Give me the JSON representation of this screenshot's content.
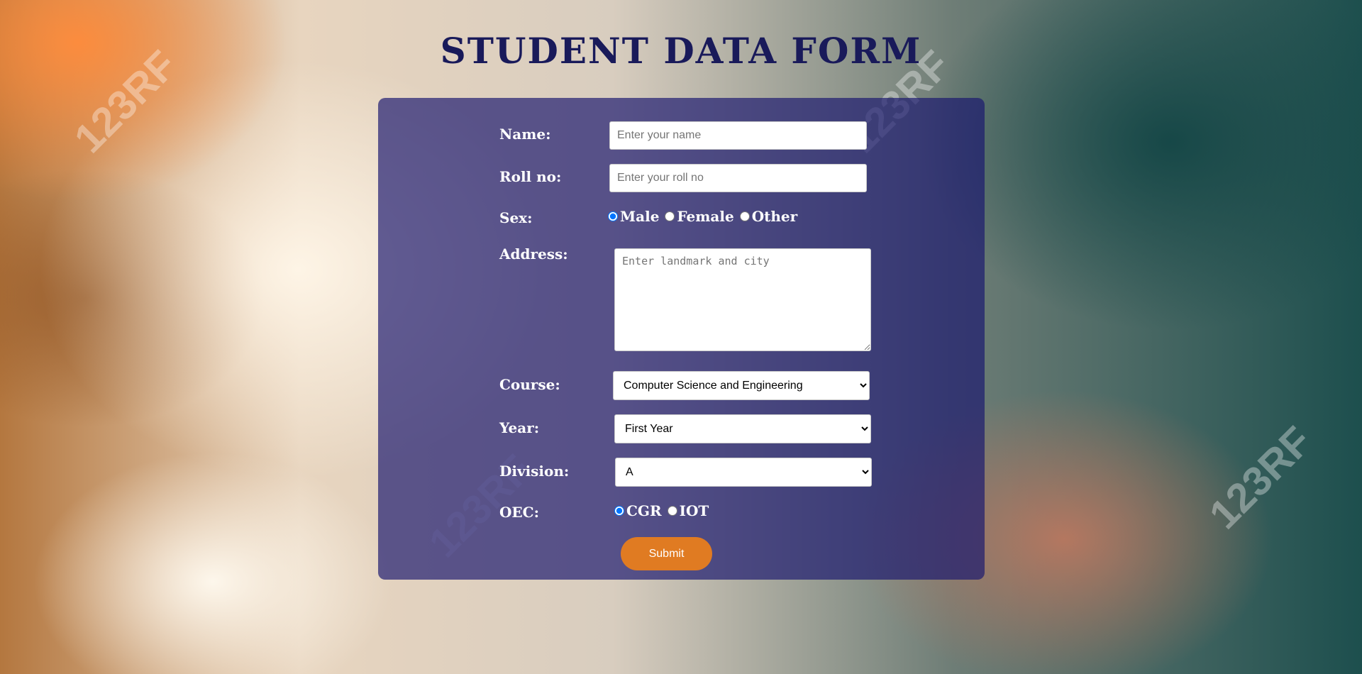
{
  "page": {
    "title": "STUDENT DATA FORM"
  },
  "form": {
    "name": {
      "label": "Name:",
      "placeholder": "Enter your name",
      "value": ""
    },
    "roll": {
      "label": "Roll no:",
      "placeholder": "Enter your roll no",
      "value": ""
    },
    "sex": {
      "label": "Sex:",
      "options": [
        "Male",
        "Female",
        "Other"
      ],
      "selected": "Male"
    },
    "address": {
      "label": "Address:",
      "placeholder": "Enter landmark and city",
      "value": ""
    },
    "course": {
      "label": "Course:",
      "selected": "Computer Science and Engineering"
    },
    "year": {
      "label": "Year:",
      "selected": "First Year"
    },
    "division": {
      "label": "Division:",
      "selected": "A"
    },
    "oec": {
      "label": "OEC:",
      "options": [
        "CGR",
        "IOT"
      ],
      "selected": "CGR"
    },
    "submit_label": "Submit"
  },
  "background": {
    "watermark_text": "123RF"
  },
  "colors": {
    "title": "#191a5a",
    "panel": "rgba(25,22,110,0.68)",
    "submit": "#e07b22",
    "label": "#ffffff"
  }
}
